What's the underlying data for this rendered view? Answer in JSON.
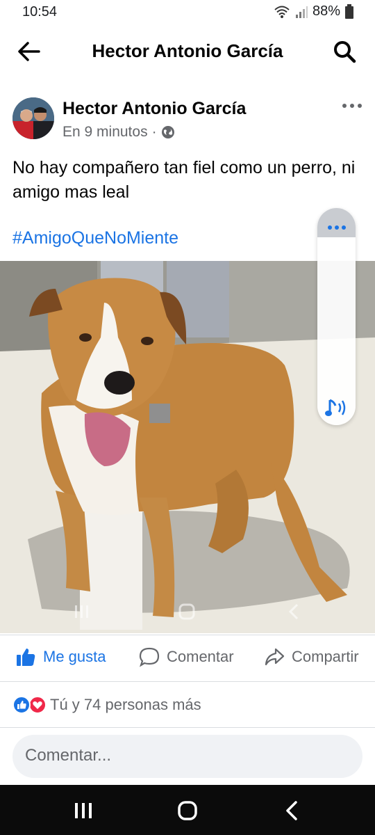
{
  "status_bar": {
    "time": "10:54",
    "battery": "88%"
  },
  "header": {
    "title": "Hector Antonio García"
  },
  "post": {
    "author": "Hector Antonio García",
    "time": "En 9 minutos",
    "separator": "·",
    "text": "No hay compañero tan fiel como un perro, ni amigo mas leal",
    "hashtag": "#AmigoQueNoMiente"
  },
  "actions": {
    "like": "Me gusta",
    "comment": "Comentar",
    "share": "Compartir"
  },
  "reactions": {
    "text": "Tú y 74 personas más"
  },
  "comment_input": {
    "placeholder": "Comentar..."
  },
  "colors": {
    "accent": "#1b74e4",
    "like_red": "#f02849",
    "secondary_text": "#65676b"
  },
  "icons": [
    "back-arrow-icon",
    "search-icon",
    "more-dots-icon",
    "globe-icon",
    "thumbs-up-icon",
    "comment-bubble-icon",
    "share-arrow-icon",
    "like-reaction-icon",
    "love-reaction-icon",
    "music-note-icon",
    "recents-icon",
    "home-icon",
    "back-chevron-icon"
  ]
}
